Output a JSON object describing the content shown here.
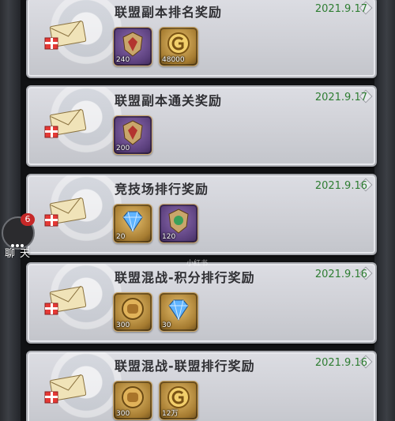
{
  "mails": [
    {
      "title": "联盟副本排名奖励",
      "date": "2021.9.17",
      "rewards": [
        {
          "icon": "crest-medal-icon",
          "qty": "240",
          "style": "purple"
        },
        {
          "icon": "gold-coin-icon",
          "qty": "48000",
          "style": "gold"
        }
      ]
    },
    {
      "title": "联盟副本通关奖励",
      "date": "2021.9.17",
      "rewards": [
        {
          "icon": "crest-medal-icon",
          "qty": "200",
          "style": "purple"
        }
      ]
    },
    {
      "title": "竞技场排行奖励",
      "date": "2021.9.16",
      "rewards": [
        {
          "icon": "diamond-icon",
          "qty": "20",
          "style": "gold"
        },
        {
          "icon": "arena-crest-icon",
          "qty": "120",
          "style": "purple"
        }
      ]
    },
    {
      "title": "联盟混战-积分排行奖励",
      "date": "2021.9.16",
      "rewards": [
        {
          "icon": "fist-token-icon",
          "qty": "300",
          "style": "gold"
        },
        {
          "icon": "diamond-icon",
          "qty": "30",
          "style": "gold"
        }
      ]
    },
    {
      "title": "联盟混战-联盟排行奖励",
      "date": "2021.9.16",
      "rewards": [
        {
          "icon": "fist-token-icon",
          "qty": "300",
          "style": "gold"
        },
        {
          "icon": "gold-coin-icon",
          "qty": "12万",
          "style": "gold"
        }
      ]
    }
  ],
  "chat": {
    "badge": "6",
    "label": "聊天"
  },
  "watermark": "小红书",
  "colors": {
    "date": "#2e7d32",
    "panel": "#d3d4da",
    "badge": "#c62828"
  }
}
